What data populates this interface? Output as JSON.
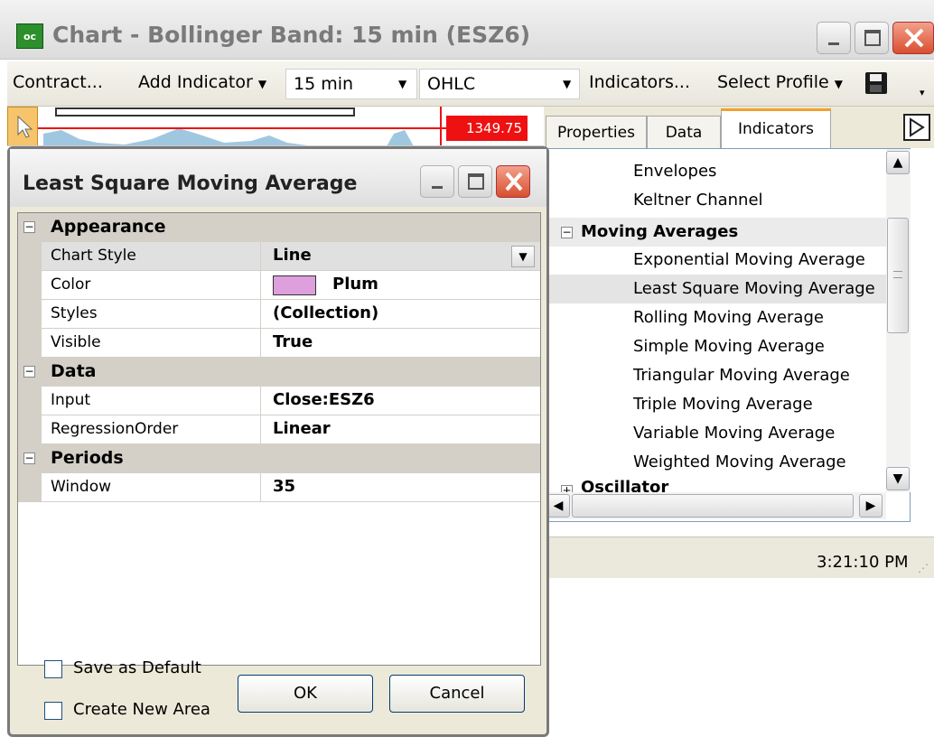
{
  "window": {
    "title": "Chart - Bollinger Band: 15 min (ESZ6)"
  },
  "toolbar": {
    "contract": "Contract...",
    "add_indicator": "Add Indicator",
    "interval": "15 min",
    "chart_type": "OHLC",
    "indicators": "Indicators...",
    "select_profile": "Select Profile"
  },
  "chart": {
    "price": "1349.75"
  },
  "tabs": [
    "Properties",
    "Data",
    "Indicators"
  ],
  "indicators_list": {
    "items_top": [
      "Envelopes",
      "Keltner Channel"
    ],
    "group_moving": "Moving Averages",
    "moving": [
      "Exponential Moving Average",
      "Least Square Moving Average",
      "Rolling Moving Average",
      "Simple Moving Average",
      "Triangular Moving Average",
      "Triple Moving Average",
      "Variable Moving Average",
      "Weighted Moving Average"
    ],
    "group_osc": "Oscillator",
    "selected": "Least Square Moving Average"
  },
  "status": {
    "time": "3:21:10 PM"
  },
  "dialog": {
    "title": "Least Square Moving Average",
    "categories": {
      "appearance": "Appearance",
      "data": "Data",
      "periods": "Periods"
    },
    "props": {
      "chart_style": {
        "key": "Chart Style",
        "value": "Line"
      },
      "color": {
        "key": "Color",
        "value": "Plum",
        "swatch": "#dda0dd"
      },
      "styles": {
        "key": "Styles",
        "value": "(Collection)"
      },
      "visible": {
        "key": "Visible",
        "value": "True"
      },
      "input": {
        "key": "Input",
        "value": "Close:ESZ6"
      },
      "regression": {
        "key": "RegressionOrder",
        "value": "Linear"
      },
      "window": {
        "key": "Window",
        "value": "35"
      }
    },
    "save_default": "Save as Default",
    "create_area": "Create New Area",
    "ok": "OK",
    "cancel": "Cancel"
  }
}
